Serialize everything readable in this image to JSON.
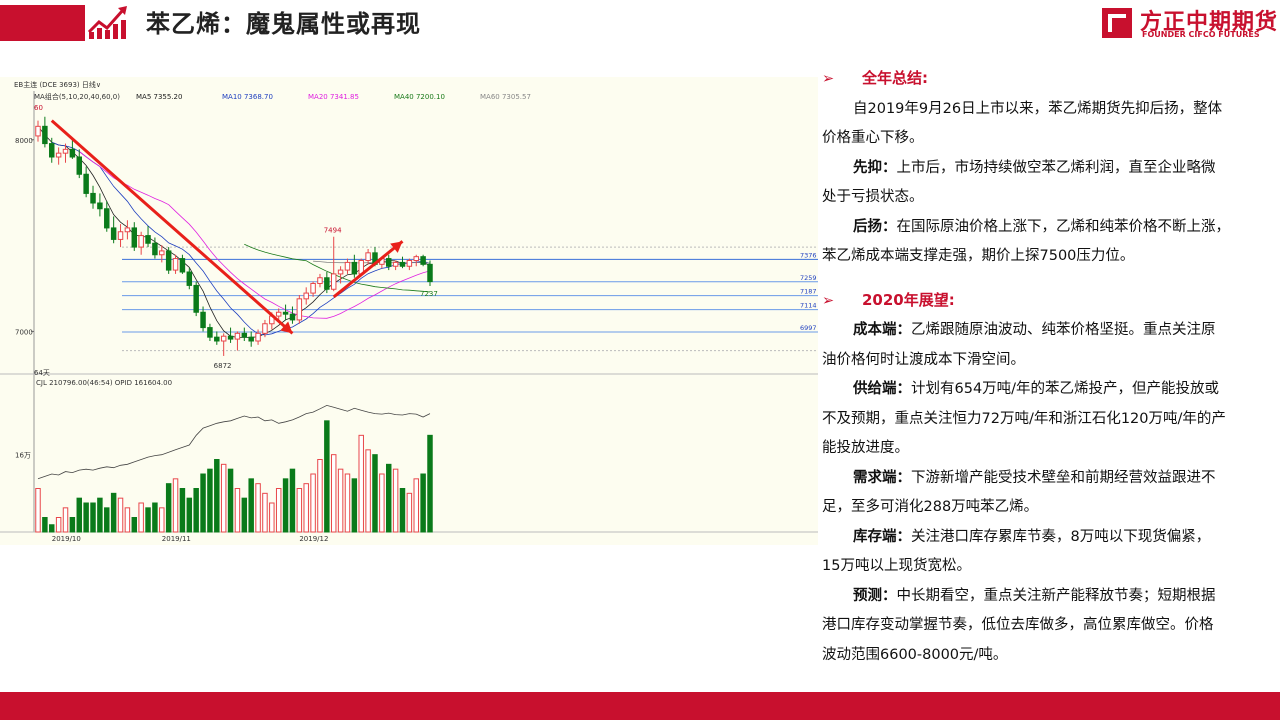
{
  "header": {
    "title": "苯乙烯：魔鬼属性或再现",
    "logo_cn": "方正中期期货",
    "logo_en": "FOUNDER CIFCO FUTURES"
  },
  "colors": {
    "accent": "#c8102e",
    "up_candle": "#e8474a",
    "down_candle": "#0a7a1a",
    "chart_bg": "#fdfdf0"
  },
  "chart_data": {
    "type": "candlestick",
    "instrument": "EB主连",
    "exchange_code": "(DCE 3693)",
    "period": "日线",
    "ma_label": "MA组合(5,10,20,40,60,0)",
    "ma_values": [
      {
        "name": "MA5",
        "value": "7355.20",
        "color": "#222222"
      },
      {
        "name": "MA10",
        "value": "7368.70",
        "color": "#1f3fbf"
      },
      {
        "name": "MA20",
        "value": "7341.85",
        "color": "#e020e0"
      },
      {
        "name": "MA40",
        "value": "7200.10",
        "color": "#1a7a1a"
      },
      {
        "name": "MA60",
        "value": "7305.57",
        "color": "#888888"
      }
    ],
    "top_left_label": "60",
    "bottom_left_label": "64天",
    "y_ticks": [
      8000,
      7000
    ],
    "ylim": [
      6830,
      8150
    ],
    "price_levels": [
      7376,
      7259,
      7187,
      7114,
      6997
    ],
    "annotations": {
      "high": "7494",
      "low": "6872",
      "last": "7237"
    },
    "arrows": [
      {
        "from": [
          "2019-10-09",
          8100
        ],
        "to": [
          "2019-11-27",
          6990
        ]
      },
      {
        "from": [
          "2019-12-05",
          7180
        ],
        "to": [
          "2019-12-19",
          7470
        ]
      }
    ],
    "x_labels": [
      "2019/10",
      "2019/11",
      "2019/12"
    ],
    "ohlc": [
      [
        8020,
        8100,
        7990,
        8070
      ],
      [
        8070,
        8120,
        7960,
        7980
      ],
      [
        7980,
        8010,
        7880,
        7910
      ],
      [
        7910,
        7960,
        7870,
        7930
      ],
      [
        7930,
        7980,
        7880,
        7950
      ],
      [
        7950,
        8000,
        7900,
        7910
      ],
      [
        7910,
        7950,
        7800,
        7820
      ],
      [
        7820,
        7860,
        7700,
        7720
      ],
      [
        7720,
        7760,
        7640,
        7670
      ],
      [
        7670,
        7720,
        7600,
        7640
      ],
      [
        7640,
        7680,
        7520,
        7540
      ],
      [
        7540,
        7600,
        7460,
        7480
      ],
      [
        7480,
        7560,
        7440,
        7520
      ],
      [
        7520,
        7580,
        7480,
        7540
      ],
      [
        7540,
        7570,
        7420,
        7440
      ],
      [
        7440,
        7520,
        7400,
        7500
      ],
      [
        7500,
        7550,
        7440,
        7460
      ],
      [
        7460,
        7490,
        7380,
        7400
      ],
      [
        7400,
        7450,
        7360,
        7420
      ],
      [
        7420,
        7440,
        7300,
        7320
      ],
      [
        7320,
        7400,
        7300,
        7380
      ],
      [
        7380,
        7400,
        7300,
        7310
      ],
      [
        7310,
        7330,
        7220,
        7240
      ],
      [
        7240,
        7260,
        7080,
        7100
      ],
      [
        7100,
        7130,
        7000,
        7020
      ],
      [
        7020,
        7040,
        6950,
        6970
      ],
      [
        6970,
        7000,
        6930,
        6950
      ],
      [
        6950,
        6990,
        6872,
        6975
      ],
      [
        6975,
        7020,
        6940,
        6960
      ],
      [
        6960,
        7000,
        6900,
        6990
      ],
      [
        6990,
        7020,
        6950,
        6970
      ],
      [
        6970,
        7000,
        6920,
        6950
      ],
      [
        6950,
        7010,
        6930,
        6990
      ],
      [
        6990,
        7060,
        6970,
        7040
      ],
      [
        7040,
        7100,
        7010,
        7080
      ],
      [
        7080,
        7120,
        7050,
        7100
      ],
      [
        7100,
        7140,
        7060,
        7090
      ],
      [
        7090,
        7130,
        7040,
        7060
      ],
      [
        7060,
        7190,
        7040,
        7170
      ],
      [
        7170,
        7230,
        7140,
        7200
      ],
      [
        7200,
        7260,
        7180,
        7250
      ],
      [
        7250,
        7300,
        7230,
        7280
      ],
      [
        7280,
        7310,
        7200,
        7220
      ],
      [
        7220,
        7494,
        7210,
        7300
      ],
      [
        7300,
        7340,
        7250,
        7320
      ],
      [
        7320,
        7380,
        7300,
        7360
      ],
      [
        7360,
        7400,
        7280,
        7300
      ],
      [
        7300,
        7380,
        7290,
        7370
      ],
      [
        7370,
        7430,
        7350,
        7410
      ],
      [
        7410,
        7440,
        7340,
        7350
      ],
      [
        7350,
        7390,
        7330,
        7380
      ],
      [
        7380,
        7400,
        7320,
        7340
      ],
      [
        7340,
        7370,
        7320,
        7360
      ],
      [
        7360,
        7390,
        7330,
        7340
      ],
      [
        7340,
        7380,
        7320,
        7370
      ],
      [
        7370,
        7400,
        7340,
        7390
      ],
      [
        7390,
        7400,
        7340,
        7350
      ],
      [
        7350,
        7370,
        7237,
        7260
      ]
    ],
    "volume_panel": {
      "label": "CJL",
      "cjl": "210796.00(46:54)",
      "opid": "OPID 161604.00",
      "y_tick": "16万",
      "ylim": [
        0,
        300000
      ],
      "volumes": [
        90000,
        30000,
        15000,
        30000,
        50000,
        30000,
        70000,
        60000,
        60000,
        70000,
        50000,
        80000,
        70000,
        50000,
        30000,
        60000,
        50000,
        60000,
        50000,
        100000,
        110000,
        90000,
        70000,
        90000,
        120000,
        130000,
        150000,
        140000,
        130000,
        90000,
        70000,
        110000,
        100000,
        80000,
        60000,
        90000,
        110000,
        130000,
        90000,
        100000,
        120000,
        150000,
        230000,
        160000,
        130000,
        120000,
        110000,
        200000,
        170000,
        160000,
        120000,
        140000,
        130000,
        90000,
        80000,
        110000,
        120000,
        200000
      ],
      "open_interest": [
        110000,
        115000,
        120000,
        118000,
        125000,
        123000,
        128000,
        130000,
        128000,
        132000,
        135000,
        133000,
        138000,
        140000,
        145000,
        150000,
        155000,
        158000,
        160000,
        165000,
        170000,
        175000,
        180000,
        200000,
        215000,
        220000,
        225000,
        228000,
        230000,
        235000,
        240000,
        236000,
        238000,
        230000,
        232000,
        225000,
        228000,
        232000,
        238000,
        245000,
        248000,
        255000,
        262000,
        258000,
        254000,
        250000,
        256000,
        252000,
        248000,
        245000,
        244000,
        246000,
        243000,
        242000,
        245000,
        244000,
        238000,
        245000
      ]
    }
  },
  "summary": {
    "section1_title": "全年总结:",
    "para1": "自2019年9月26日上市以来，苯乙烯期货先抑后扬，整体",
    "para1b": "价格重心下移。",
    "xianyi_label": "先抑：",
    "xianyi_text": "上市后，市场持续做空苯乙烯利润，直至企业略微",
    "xianyi_text2": "处于亏损状态。",
    "houyang_label": "后扬：",
    "houyang_text": "在国际原油价格上涨下，乙烯和纯苯价格不断上涨，",
    "houyang_text2": "苯乙烯成本端支撑走强，期价上探7500压力位。",
    "section2_title": "2020年展望:",
    "cost_label": "成本端：",
    "cost_text": "乙烯跟随原油波动、纯苯价格坚挺。重点关注原",
    "cost_text2": "油价格何时让渡成本下滑空间。",
    "supply_label": "供给端：",
    "supply_text": "计划有654万吨/年的苯乙烯投产，但产能投放或",
    "supply_text2": "不及预期，重点关注恒力72万吨/年和浙江石化120万吨/年的产",
    "supply_text3": "能投放进度。",
    "demand_label": "需求端：",
    "demand_text": "下游新增产能受技术壁垒和前期经营效益跟进不",
    "demand_text2": "足，至多可消化288万吨苯乙烯。",
    "stock_label": "库存端：",
    "stock_text": "关注港口库存累库节奏，8万吨以下现货偏紧，",
    "stock_text2": "15万吨以上现货宽松。",
    "forecast_label": "预测：",
    "forecast_text": "中长期看空，重点关注新产能释放节奏；短期根据",
    "forecast_text2": "港口库存变动掌握节奏，低位去库做多，高位累库做空。价格",
    "forecast_text3": "波动范围6600-8000元/吨。"
  }
}
